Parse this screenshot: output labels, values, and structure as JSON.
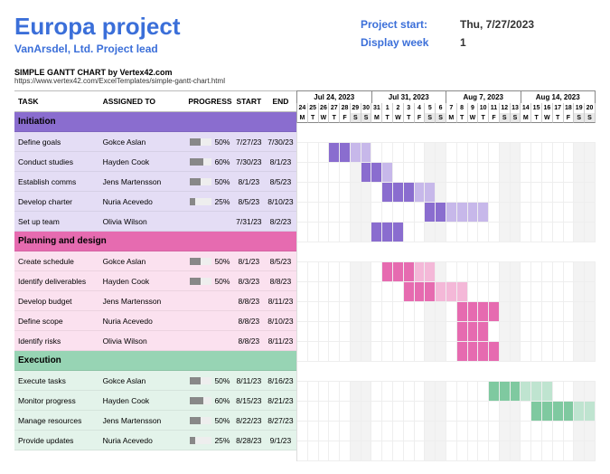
{
  "header": {
    "title": "Europa project",
    "subtitle": "VanArsdel, Ltd.   Project lead",
    "credit": "SIMPLE GANTT CHART by Vertex42.com",
    "credit_url": "https://www.vertex42.com/ExcelTemplates/simple-gantt-chart.html",
    "project_start_label": "Project start:",
    "project_start_value": "Thu, 7/27/2023",
    "display_week_label": "Display week",
    "display_week_value": "1"
  },
  "columns": {
    "task": "TASK",
    "assigned": "ASSIGNED TO",
    "progress": "PROGRESS",
    "start": "START",
    "end": "END"
  },
  "timeline": {
    "start_date": "2023-07-24",
    "weeks": [
      "Jul 24, 2023",
      "Jul 31, 2023",
      "Aug 7, 2023",
      "Aug 14, 2023"
    ],
    "day_numbers": [
      24,
      25,
      26,
      27,
      28,
      29,
      30,
      31,
      1,
      2,
      3,
      4,
      5,
      6,
      7,
      8,
      9,
      10,
      11,
      12,
      13,
      14,
      15,
      16,
      17,
      18,
      19,
      20
    ],
    "dow": [
      "M",
      "T",
      "W",
      "T",
      "F",
      "S",
      "S",
      "M",
      "T",
      "W",
      "T",
      "F",
      "S",
      "S",
      "M",
      "T",
      "W",
      "T",
      "F",
      "S",
      "S",
      "M",
      "T",
      "W",
      "T",
      "F",
      "S",
      "S"
    ]
  },
  "sections": [
    {
      "name": "Initiation",
      "color": "#8a6dcf",
      "light": "#c7b8ea",
      "tasks": [
        {
          "task": "Define goals",
          "assigned": "Gokce Aslan",
          "progress": 50,
          "start": "7/27/23",
          "end": "7/30/23",
          "s": 3,
          "d": 4
        },
        {
          "task": "Conduct studies",
          "assigned": "Hayden Cook",
          "progress": 60,
          "start": "7/30/23",
          "end": "8/1/23",
          "s": 6,
          "d": 3
        },
        {
          "task": "Establish comms",
          "assigned": "Jens Martensson",
          "progress": 50,
          "start": "8/1/23",
          "end": "8/5/23",
          "s": 8,
          "d": 5
        },
        {
          "task": "Develop charter",
          "assigned": "Nuria Acevedo",
          "progress": 25,
          "start": "8/5/23",
          "end": "8/10/23",
          "s": 12,
          "d": 6
        },
        {
          "task": "Set up team",
          "assigned": "Olivia Wilson",
          "progress": "",
          "start": "7/31/23",
          "end": "8/2/23",
          "s": 7,
          "d": 3
        }
      ]
    },
    {
      "name": "Planning and design",
      "color": "#e66bb0",
      "light": "#f4b8d8",
      "tasks": [
        {
          "task": "Create schedule",
          "assigned": "Gokce Aslan",
          "progress": 50,
          "start": "8/1/23",
          "end": "8/5/23",
          "s": 8,
          "d": 5
        },
        {
          "task": "Identify deliverables",
          "assigned": "Hayden Cook",
          "progress": 50,
          "start": "8/3/23",
          "end": "8/8/23",
          "s": 10,
          "d": 6
        },
        {
          "task": "Develop budget",
          "assigned": "Jens Martensson",
          "progress": "",
          "start": "8/8/23",
          "end": "8/11/23",
          "s": 15,
          "d": 4
        },
        {
          "task": "Define scope",
          "assigned": "Nuria Acevedo",
          "progress": "",
          "start": "8/8/23",
          "end": "8/10/23",
          "s": 15,
          "d": 3
        },
        {
          "task": "Identify risks",
          "assigned": "Olivia Wilson",
          "progress": "",
          "start": "8/8/23",
          "end": "8/11/23",
          "s": 15,
          "d": 4
        }
      ]
    },
    {
      "name": "Execution",
      "color": "#7fc9a0",
      "light": "#bfe4d0",
      "tasks": [
        {
          "task": "Execute tasks",
          "assigned": "Gokce Aslan",
          "progress": 50,
          "start": "8/11/23",
          "end": "8/16/23",
          "s": 18,
          "d": 6
        },
        {
          "task": "Monitor progress",
          "assigned": "Hayden Cook",
          "progress": 60,
          "start": "8/15/23",
          "end": "8/21/23",
          "s": 22,
          "d": 6
        },
        {
          "task": "Manage resources",
          "assigned": "Jens Martensson",
          "progress": 50,
          "start": "8/22/23",
          "end": "8/27/23",
          "s": 29,
          "d": 6
        },
        {
          "task": "Provide updates",
          "assigned": "Nuria Acevedo",
          "progress": 25,
          "start": "8/28/23",
          "end": "9/1/23",
          "s": 35,
          "d": 5
        }
      ]
    }
  ],
  "chart_data": {
    "type": "gantt",
    "title": "Europa project",
    "x_start": "2023-07-24",
    "x_end": "2023-08-20",
    "series": [
      {
        "section": "Initiation",
        "task": "Define goals",
        "start": "2023-07-27",
        "end": "2023-07-30",
        "progress": 50
      },
      {
        "section": "Initiation",
        "task": "Conduct studies",
        "start": "2023-07-30",
        "end": "2023-08-01",
        "progress": 60
      },
      {
        "section": "Initiation",
        "task": "Establish comms",
        "start": "2023-08-01",
        "end": "2023-08-05",
        "progress": 50
      },
      {
        "section": "Initiation",
        "task": "Develop charter",
        "start": "2023-08-05",
        "end": "2023-08-10",
        "progress": 25
      },
      {
        "section": "Initiation",
        "task": "Set up team",
        "start": "2023-07-31",
        "end": "2023-08-02",
        "progress": null
      },
      {
        "section": "Planning and design",
        "task": "Create schedule",
        "start": "2023-08-01",
        "end": "2023-08-05",
        "progress": 50
      },
      {
        "section": "Planning and design",
        "task": "Identify deliverables",
        "start": "2023-08-03",
        "end": "2023-08-08",
        "progress": 50
      },
      {
        "section": "Planning and design",
        "task": "Develop budget",
        "start": "2023-08-08",
        "end": "2023-08-11",
        "progress": null
      },
      {
        "section": "Planning and design",
        "task": "Define scope",
        "start": "2023-08-08",
        "end": "2023-08-10",
        "progress": null
      },
      {
        "section": "Planning and design",
        "task": "Identify risks",
        "start": "2023-08-08",
        "end": "2023-08-11",
        "progress": null
      },
      {
        "section": "Execution",
        "task": "Execute tasks",
        "start": "2023-08-11",
        "end": "2023-08-16",
        "progress": 50
      },
      {
        "section": "Execution",
        "task": "Monitor progress",
        "start": "2023-08-15",
        "end": "2023-08-21",
        "progress": 60
      },
      {
        "section": "Execution",
        "task": "Manage resources",
        "start": "2023-08-22",
        "end": "2023-08-27",
        "progress": 50
      },
      {
        "section": "Execution",
        "task": "Provide updates",
        "start": "2023-08-28",
        "end": "2023-09-01",
        "progress": 25
      }
    ]
  }
}
